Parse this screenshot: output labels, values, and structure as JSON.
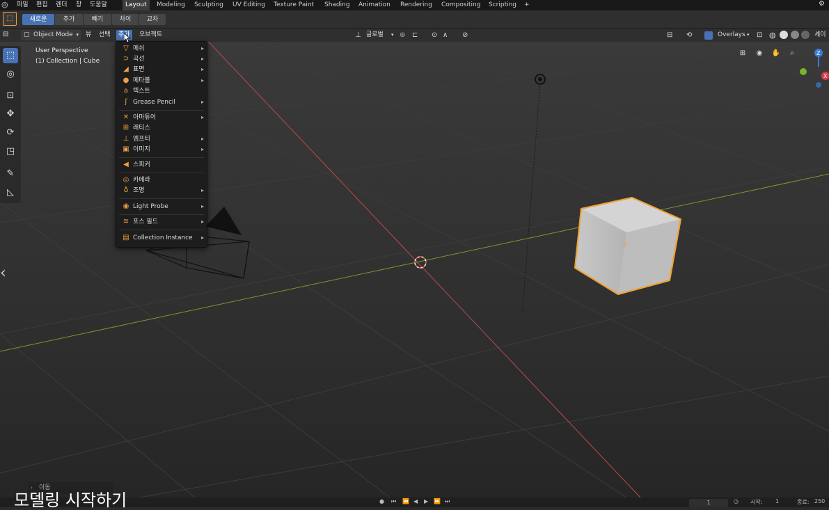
{
  "topbar": {
    "menus": [
      "파일",
      "편집",
      "렌더",
      "창",
      "도움말"
    ],
    "workspaces": [
      "Layout",
      "Modeling",
      "Sculpting",
      "UV Editing",
      "Texture Paint",
      "Shading",
      "Animation",
      "Rendering",
      "Compositing",
      "Scripting"
    ],
    "active_workspace": "Layout",
    "add_workspace": "+"
  },
  "tool_settings": {
    "modes": [
      "새로운",
      "추가",
      "빼기",
      "차이",
      "교차"
    ]
  },
  "header": {
    "mode": "Object Mode",
    "menus": [
      "뷰",
      "선택",
      "추가",
      "오브젝트"
    ],
    "transform_orientation": "글로벌",
    "overlays_label": "Overlays",
    "shading_label": "셰이"
  },
  "viewport": {
    "view_name": "User Perspective",
    "collection_info": "(1) Collection | Cube"
  },
  "add_menu": {
    "items": [
      {
        "icon": "▽",
        "label": "메쉬"
      },
      {
        "icon": "⊃",
        "label": "곡선"
      },
      {
        "icon": "◢",
        "label": "표면"
      },
      {
        "icon": "●",
        "label": "메타볼"
      },
      {
        "icon": "a",
        "label": "텍스트"
      },
      {
        "icon": "ʃ",
        "label": "Grease Pencil"
      },
      {
        "icon": "✕",
        "label": "아마튜어"
      },
      {
        "icon": "⊞",
        "label": "래티스"
      },
      {
        "icon": "⊥",
        "label": "엠프티"
      },
      {
        "icon": "▣",
        "label": "이미지"
      },
      {
        "icon": "◀",
        "label": "스피커"
      },
      {
        "icon": "◎",
        "label": "카메라"
      },
      {
        "icon": "♁",
        "label": "조명"
      },
      {
        "icon": "◉",
        "label": "Light Probe"
      },
      {
        "icon": "≋",
        "label": "포스 필드"
      },
      {
        "icon": "▤",
        "label": "Collection Instance"
      }
    ],
    "submenu_arrow": "▸"
  },
  "bottom": {
    "last_operator": "이동",
    "subtitle": "모델링 시작하기",
    "frame_current": "1",
    "start_label": "시작:",
    "start_value": "1",
    "end_label": "종료:",
    "end_value": "250"
  },
  "colors": {
    "accent": "#4772b3",
    "selection_outline": "#f0a030",
    "x_axis": "#c0484a",
    "y_axis": "#7a9a2a"
  }
}
